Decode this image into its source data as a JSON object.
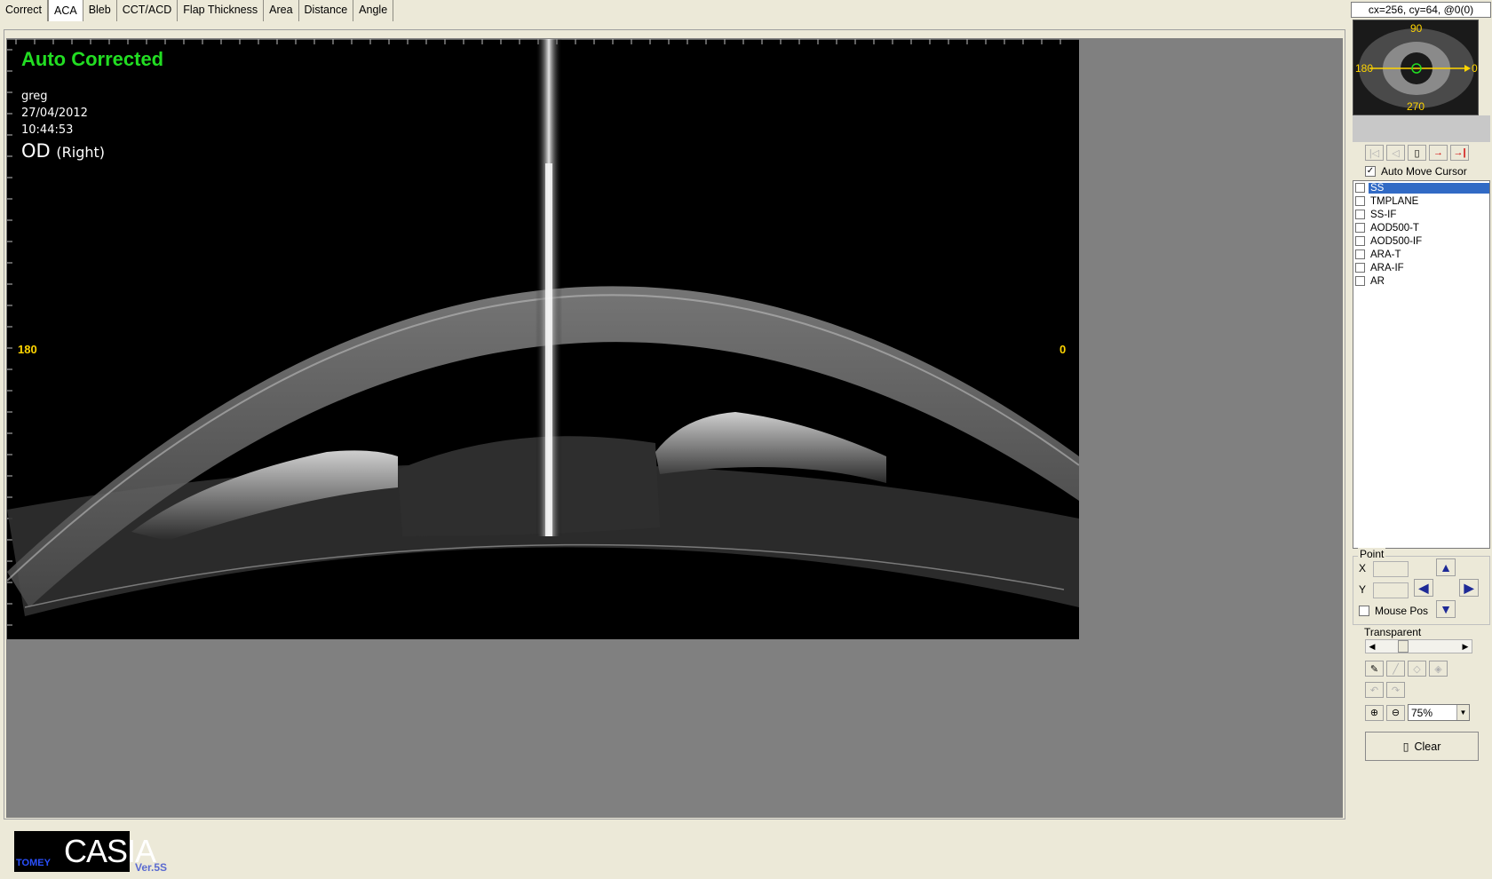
{
  "tabs": [
    "Correct",
    "ACA",
    "Bleb",
    "CCT/ACD",
    "Flap Thickness",
    "Area",
    "Distance",
    "Angle"
  ],
  "active_tab": "ACA",
  "cursor_readout": "cx=256, cy=64, @0(0)",
  "scan": {
    "status": "Auto Corrected",
    "patient": "greg",
    "date": "27/04/2012",
    "time": "10:44:53",
    "eye_code": "OD",
    "eye_side": "(Right)",
    "angle_left": "180",
    "angle_right": "0"
  },
  "thumbnail": {
    "top": "90",
    "left": "180",
    "right": "0",
    "bottom": "270"
  },
  "auto_move_cursor": {
    "label": "Auto Move Cursor",
    "checked": true
  },
  "measurements": [
    {
      "label": "SS",
      "selected": true
    },
    {
      "label": "TMPLANE",
      "selected": false
    },
    {
      "label": "SS-IF",
      "selected": false
    },
    {
      "label": "AOD500-T",
      "selected": false
    },
    {
      "label": "AOD500-IF",
      "selected": false
    },
    {
      "label": "ARA-T",
      "selected": false
    },
    {
      "label": "ARA-IF",
      "selected": false
    },
    {
      "label": "AR",
      "selected": false
    }
  ],
  "point": {
    "title": "Point",
    "x_label": "X",
    "y_label": "Y",
    "mouse_pos_label": "Mouse Pos"
  },
  "transparent_label": "Transparent",
  "zoom": "75%",
  "clear_label": "Clear",
  "brand": {
    "tomey": "TOMEY",
    "casia": "CASIA",
    "version": "Ver.5S"
  },
  "colors": {
    "status_green": "#22dd22",
    "angle_yellow": "#ffd500",
    "selection_blue": "#316AC5",
    "panel_bg": "#ECE9D8"
  }
}
